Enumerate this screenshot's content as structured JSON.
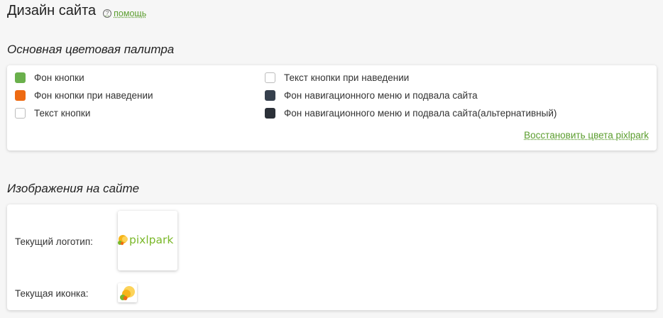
{
  "header": {
    "title": "Дизайн сайта",
    "help_label": "помощь"
  },
  "palette": {
    "section_title": "Основная цветовая палитра",
    "items": [
      {
        "label": "Фон кнопки",
        "color": "#6ab04c"
      },
      {
        "label": "Фон кнопки при наведении",
        "color": "#ee6a12"
      },
      {
        "label": "Текст кнопки",
        "color": "#ffffff"
      },
      {
        "label": "Текст кнопки при наведении",
        "color": "#ffffff"
      },
      {
        "label": "Фон навигационного меню и подвала сайта",
        "color": "#36404d"
      },
      {
        "label": "Фон навигационного меню и подвала сайта(альтернативный)",
        "color": "#2b3038"
      }
    ],
    "restore_label": "Восстановить цвета pixlpark"
  },
  "images": {
    "section_title": "Изображения на сайте",
    "logo_label": "Текущий логотип:",
    "icon_label": "Текущая иконка:",
    "logo_text": "pixlpark",
    "logo_color": "#7ab829"
  }
}
